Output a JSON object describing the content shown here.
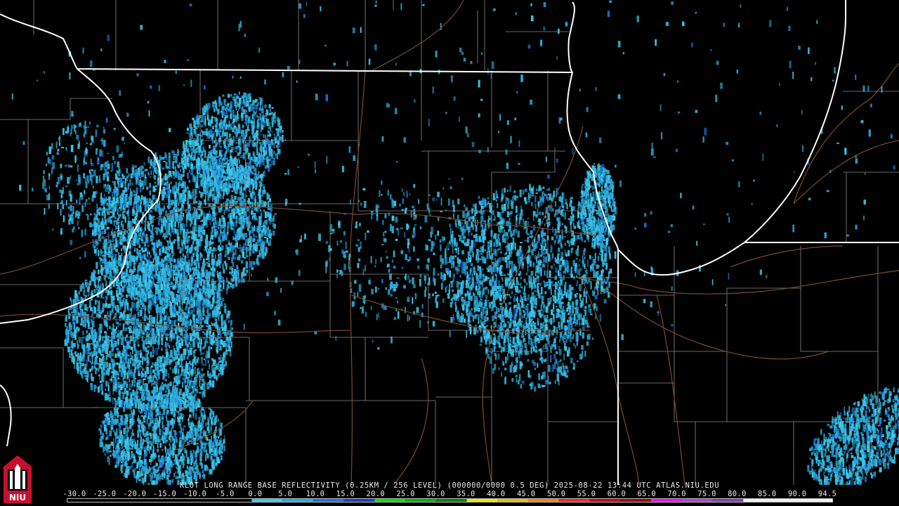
{
  "product": {
    "caption": "KLOT LONG RANGE BASE REFLECTIVITY (0.25KM / 256 LEVEL) (000000/0000 0.5 DEG) 2025-08-22 13:44 UTC  ATLAS.NIU.EDU"
  },
  "legend": {
    "tick_labels": [
      "-30.0",
      "-25.0",
      "-20.0",
      "-15.0",
      "-10.0",
      "-5.0",
      "0.0",
      "5.0",
      "10.0",
      "15.0",
      "20.0",
      "25.0",
      "30.0",
      "35.0",
      "40.0",
      "45.0",
      "50.0",
      "55.0",
      "60.0",
      "65.0",
      "70.0",
      "75.0",
      "80.0",
      "85.0",
      "90.0",
      "94.5"
    ],
    "colors": {
      "below_zero": "#000000",
      "0": "#3cc8e8",
      "5": "#2aa8e0",
      "10": "#1c70d8",
      "15": "#1440c8",
      "20": "#00e000",
      "25": "#00b000",
      "30": "#008000",
      "35": "#e8e800",
      "40": "#e8b800",
      "45": "#e88800",
      "50": "#ff2020",
      "55": "#d00000",
      "60": "#a00000",
      "65": "#ff00ff",
      "70": "#b040d0",
      "75": "#8040b0",
      "80": "#f0f0f0",
      "94.5": "#ffffff"
    }
  },
  "map_colors": {
    "state_border": "#ffffff",
    "county_line": "#8a8a8a",
    "highway": "#7a4a2e",
    "echo_light": "#3cc8e8",
    "echo_mid": "#2aa8e0",
    "echo_heavy": "#1c70d8"
  },
  "logo": {
    "text": "NIU",
    "color": "#c8102e"
  }
}
